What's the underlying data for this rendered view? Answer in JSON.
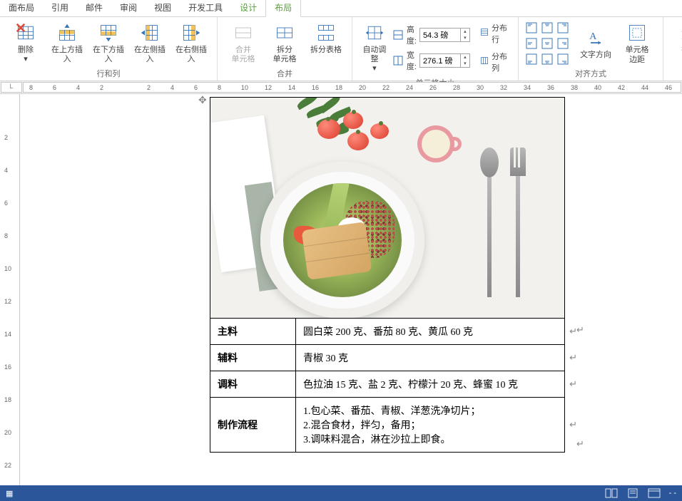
{
  "tabs": {
    "page_layout": "面布局",
    "references": "引用",
    "mailings": "邮件",
    "review": "审阅",
    "view": "视图",
    "developer": "开发工具",
    "design": "设计",
    "layout": "布局"
  },
  "ribbon": {
    "delete": "删除",
    "insert_above": "在上方插入",
    "insert_below": "在下方插入",
    "insert_left": "在左侧插入",
    "insert_right": "在右侧插入",
    "group_rows_cols": "行和列",
    "merge_cells": "合并\n单元格",
    "split_cells": "拆分\n单元格",
    "split_table": "拆分表格",
    "group_merge": "合并",
    "autofit": "自动调整",
    "height_label": "高度:",
    "width_label": "宽度:",
    "height_value": "54.3 磅",
    "width_value": "276.1 磅",
    "distribute_rows": "分布行",
    "distribute_cols": "分布列",
    "group_cell_size": "单元格大小",
    "text_direction": "文字方向",
    "cell_margins": "单元格\n边距",
    "group_alignment": "对齐方式",
    "sort": "排序"
  },
  "ruler": {
    "h_ticks": [
      "8",
      "6",
      "4",
      "2",
      "",
      "2",
      "4",
      "6",
      "8",
      "10",
      "12",
      "14",
      "16",
      "18",
      "20",
      "22",
      "24",
      "26",
      "28",
      "30",
      "32",
      "34",
      "36",
      "38",
      "40",
      "42",
      "44",
      "46"
    ],
    "v_ticks": [
      "",
      "2",
      "4",
      "6",
      "8",
      "10",
      "12",
      "14",
      "16",
      "18",
      "20",
      "22"
    ],
    "corner": "L"
  },
  "recipe": {
    "rows": [
      {
        "label": "主料",
        "value": "圆白菜 200 克、番茄 80 克、黄瓜 60 克"
      },
      {
        "label": "辅料",
        "value": "青椒 30 克"
      },
      {
        "label": "调料",
        "value": "色拉油 15 克、盐 2 克、柠檬汁 20 克、蜂蜜 10 克"
      },
      {
        "label": "制作流程",
        "value": "1.包心菜、番茄、青椒、洋葱洗净切片；\n2.混合食材，拌匀，备用；\n3.调味料混合，淋在沙拉上即食。"
      }
    ]
  },
  "statusbar": {
    "zoom_indicator": "- -"
  }
}
